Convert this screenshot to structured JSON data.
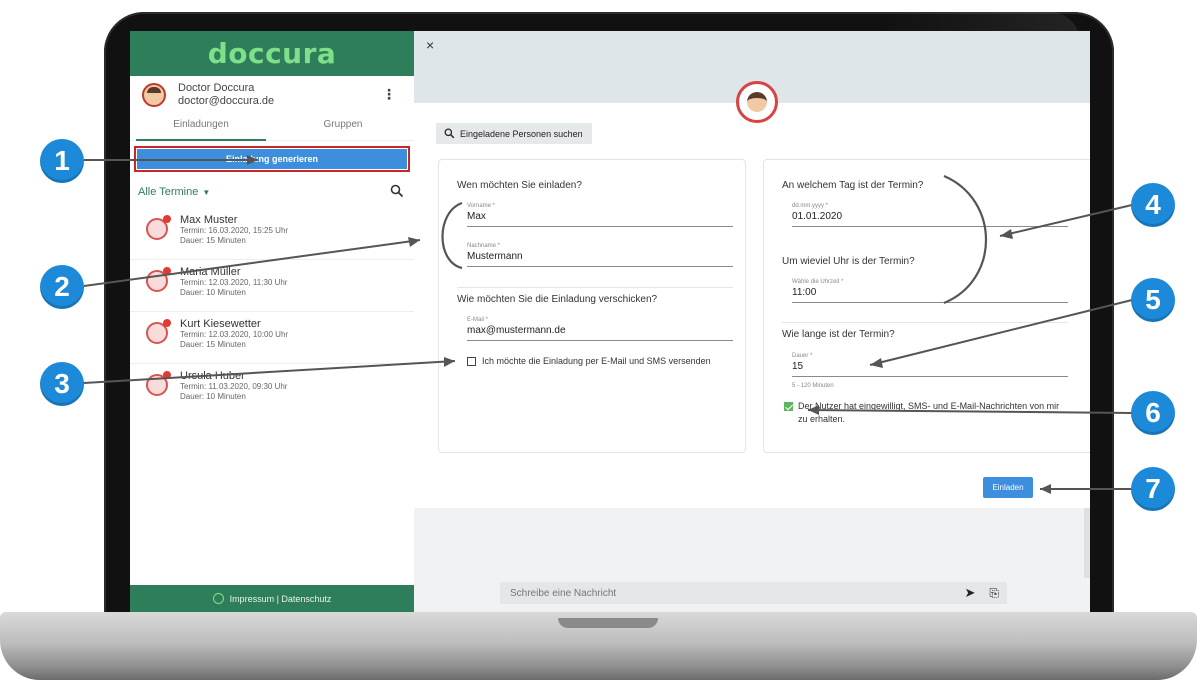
{
  "sidebar": {
    "logo": "doccura",
    "profile": {
      "name": "Doctor Doccura",
      "email": "doctor@doccura.de"
    },
    "tabs": [
      "Einladungen",
      "Gruppen"
    ],
    "generate_button": "Einladung generieren",
    "filter": "Alle Termine",
    "appointments": [
      {
        "name": "Max Muster",
        "termin": "Termin: 16.03.2020, 15:25 Uhr",
        "dauer": "Dauer: 15 Minuten"
      },
      {
        "name": "Maria Müller",
        "termin": "Termin: 12.03.2020, 11:30 Uhr",
        "dauer": "Dauer: 10 Minuten"
      },
      {
        "name": "Kurt Kiesewetter",
        "termin": "Termin: 12.03.2020, 10:00 Uhr",
        "dauer": "Dauer: 15 Minuten"
      },
      {
        "name": "Ursula Huber",
        "termin": "Termin: 11.03.2020, 09:30 Uhr",
        "dauer": "Dauer: 10 Minuten"
      }
    ],
    "footer": "Impressum | Datenschutz"
  },
  "main": {
    "close": "×",
    "search_button": "Eingeladene Personen suchen",
    "left_card": {
      "question_who": "Wen möchten Sie einladen?",
      "vorname_label": "Vorname *",
      "vorname_value": "Max",
      "nachname_label": "Nachname *",
      "nachname_value": "Mustermann",
      "question_how": "Wie möchten Sie die Einladung verschicken?",
      "email_label": "E-Mail *",
      "email_value": "max@mustermann.de",
      "sms_checkbox": "Ich möchte die Einladung per E-Mail und SMS versenden"
    },
    "right_card": {
      "question_day": "An welchem Tag ist der Termin?",
      "date_label": "dd.mm.yyyy *",
      "date_value": "01.01.2020",
      "question_time": "Um wieviel Uhr is der Termin?",
      "time_label": "Wähle die Uhrzeit *",
      "time_value": "11:00",
      "question_duration": "Wie lange ist der Termin?",
      "duration_label": "Dauer *",
      "duration_value": "15",
      "duration_hint": "5 - 120 Minuten",
      "consent_line1": "Der Nutzer hat eingewilligt, SMS- und E-Mail-Nachrichten von mir",
      "consent_line2": "zu erhalten."
    },
    "invite_button": "Einladen",
    "message_placeholder": "Schreibe eine Nachricht"
  },
  "callouts": [
    "1",
    "2",
    "3",
    "4",
    "5",
    "6",
    "7"
  ],
  "colors": {
    "brand_green": "#2e7d5b",
    "accent_blue": "#3d8fde",
    "callout_blue": "#1c8ad8",
    "highlight_red": "#c62828"
  }
}
